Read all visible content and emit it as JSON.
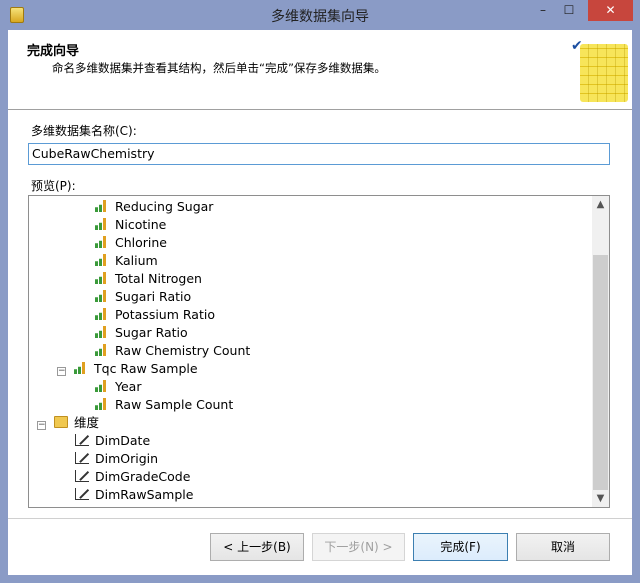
{
  "window": {
    "title": "多维数据集向导",
    "minimize": "–",
    "maximize": "☐",
    "close": "✕"
  },
  "header": {
    "title": "完成向导",
    "subtitle": "命名多维数据集并查看其结构，然后单击“完成”保存多维数据集。"
  },
  "name_label": "多维数据集名称(C):",
  "name_value": "CubeRawChemistry",
  "preview_label": "预览(P):",
  "tree": {
    "measures": [
      "Reducing Sugar",
      "Nicotine",
      "Chlorine",
      "Kalium",
      "Total Nitrogen",
      "Sugari Ratio",
      "Potassium Ratio",
      "Sugar Ratio",
      "Raw Chemistry Count"
    ],
    "group": {
      "label": "Tqc Raw Sample",
      "items": [
        "Year",
        "Raw Sample Count"
      ]
    },
    "dim_folder": "维度",
    "dimensions": [
      "DimDate",
      "DimOrigin",
      "DimGradeCode",
      "DimRawSample"
    ]
  },
  "buttons": {
    "back": "< 上一步(B)",
    "next": "下一步(N) >",
    "finish": "完成(F)",
    "cancel": "取消"
  }
}
